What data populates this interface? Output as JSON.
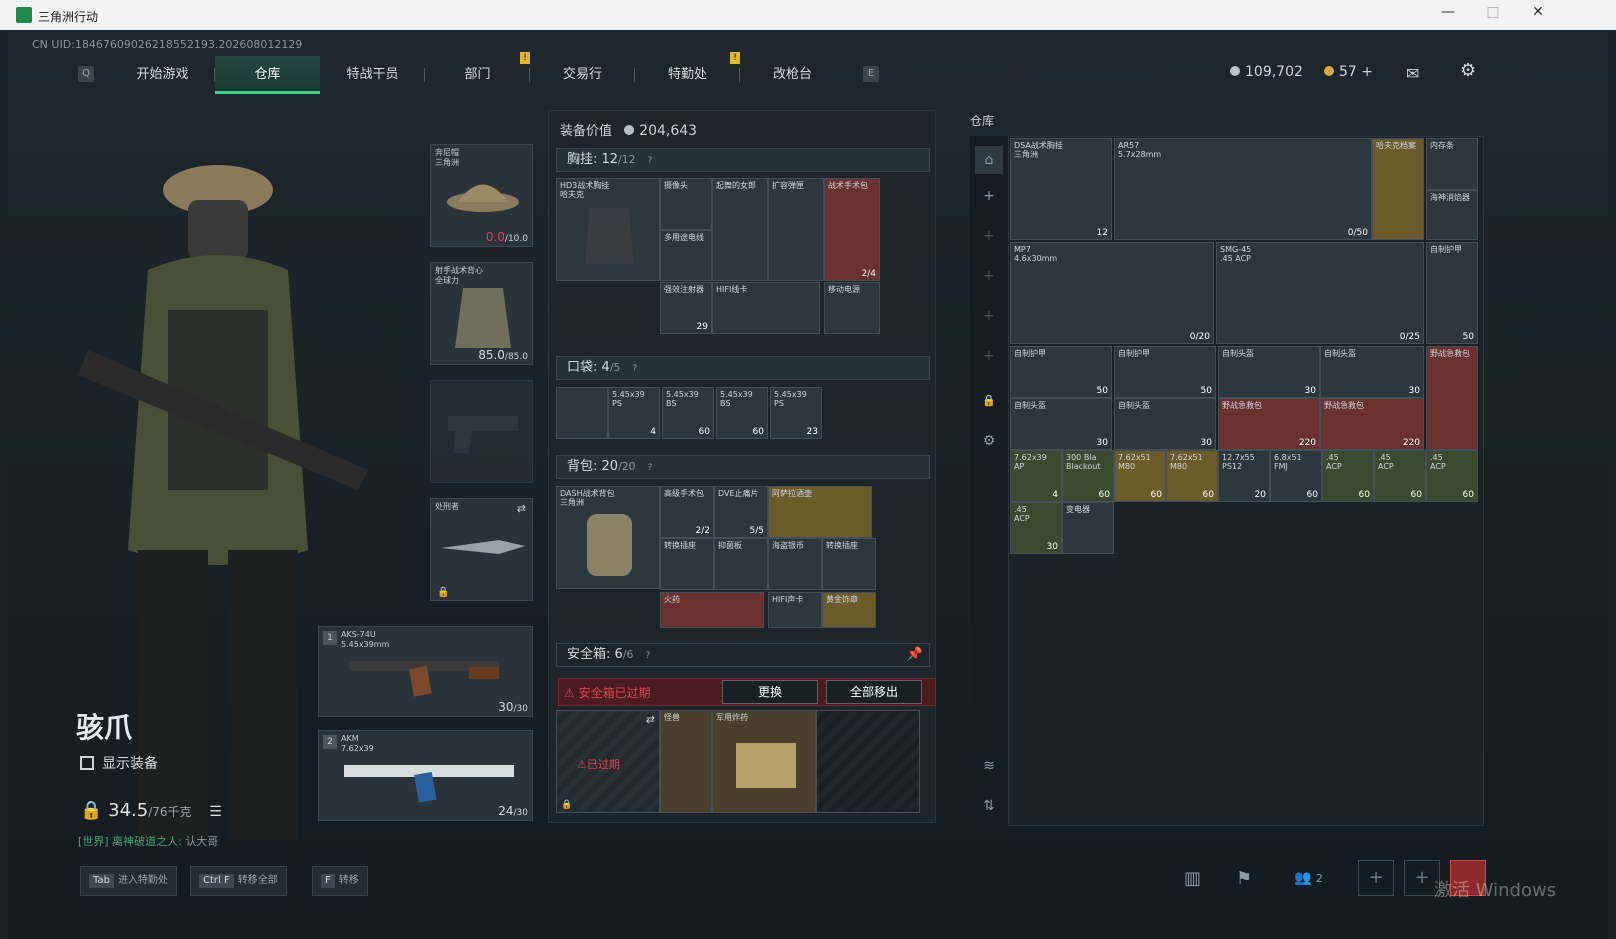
{
  "window": {
    "title": "三角洲行动"
  },
  "uid": "CN UID:1846760902621855219​3.202608012129",
  "nav": {
    "tabs": [
      "开始游戏",
      "仓库",
      "特战干员",
      "部门",
      "交易行",
      "特勤处",
      "改枪台"
    ],
    "active_index": 1,
    "left_key": "Q",
    "right_key": "E"
  },
  "currency": {
    "coins": "109,702",
    "gold": "57"
  },
  "character": {
    "name": "骇爪",
    "show_equipment": "显示装备",
    "weight": "34.5",
    "weight_max": "/76千克",
    "chat_channel": "[世界]",
    "chat_name": "离神破道之人:",
    "chat_msg": "认大哥"
  },
  "equip": {
    "helmet": {
      "label": "奔尼帽\n三角洲",
      "value": "0.0",
      "max": "/10.0"
    },
    "armor": {
      "label": "射手战术背心\n全球力",
      "value": "85.0",
      "max": "/85.0"
    },
    "melee": {
      "label": "处刑者"
    },
    "primary": {
      "num": "1",
      "label": "AKS-74U\n5.45x39mm",
      "ammo": "30",
      "max": "/30"
    },
    "secondary": {
      "num": "2",
      "label": "AKM\n7.62x39",
      "ammo": "24",
      "max": "/30"
    }
  },
  "gear": {
    "value_label": "装备价值",
    "value": "204,643",
    "chest": {
      "label": "胸挂:",
      "count": "12",
      "max": "/12",
      "item": "HD3战术胸挂\n哈夫克"
    },
    "chest_items": [
      {
        "name": "摄像头",
        "cnt": ""
      },
      {
        "name": "起舞的女郎",
        "cnt": ""
      },
      {
        "name": "扩容弹匣",
        "cnt": ""
      },
      {
        "name": "战术手术包",
        "cnt": "2/4"
      },
      {
        "name": "多用途电线",
        "cnt": ""
      },
      {
        "name": "强效注射器",
        "cnt": "29"
      },
      {
        "name": "HIFI线卡",
        "cnt": ""
      },
      {
        "name": "移动电源",
        "cnt": ""
      }
    ],
    "pocket": {
      "label": "口袋:",
      "count": "4",
      "max": "/5"
    },
    "pocket_items": [
      {
        "name": "5.45x39\nPS",
        "cnt": "4"
      },
      {
        "name": "5.45x39\nBS",
        "cnt": "60"
      },
      {
        "name": "5.45x39\nBS",
        "cnt": "60"
      },
      {
        "name": "5.45x39\nPS",
        "cnt": "23"
      }
    ],
    "backpack": {
      "label": "背包:",
      "count": "20",
      "max": "/20",
      "item": "DASH战术背包\n三角洲"
    },
    "backpack_items": [
      {
        "name": "高级手术包",
        "cnt": "2/2"
      },
      {
        "name": "DVE止痛片",
        "cnt": "5/5"
      },
      {
        "name": "阿萨拉酒壶",
        "cnt": ""
      },
      {
        "name": "转换插座",
        "cnt": ""
      },
      {
        "name": "抑菌板",
        "cnt": ""
      },
      {
        "name": "海盗银币",
        "cnt": ""
      },
      {
        "name": "转换插座",
        "cnt": ""
      },
      {
        "name": "火药",
        "cnt": ""
      },
      {
        "name": "HIFI声卡",
        "cnt": ""
      },
      {
        "name": "黄金饰章",
        "cnt": ""
      }
    ],
    "safebox": {
      "label": "安全箱:",
      "count": "6",
      "max": "/6",
      "expired": "安全箱已过期",
      "expired_tag": "已过期",
      "replace": "更换",
      "remove_all": "全部移出",
      "items": [
        "怪兽",
        "军用炸药"
      ]
    }
  },
  "warehouse": {
    "title": "仓库",
    "items": [
      {
        "name": "DSA战术胸挂\n三角洲",
        "cnt": "12"
      },
      {
        "name": "AR57\n5.7x28mm",
        "cnt": "0/50"
      },
      {
        "name": "哈夫克档案",
        "cnt": ""
      },
      {
        "name": "内存条",
        "cnt": ""
      },
      {
        "name": "海神消焰器",
        "cnt": ""
      },
      {
        "name": "MP7\n4.6x30mm",
        "cnt": "0/20"
      },
      {
        "name": "SMG-45\n.45 ACP",
        "cnt": "0/25"
      },
      {
        "name": "自制护甲",
        "cnt": "50"
      },
      {
        "name": "自制护甲",
        "cnt": "50"
      },
      {
        "name": "自制护甲",
        "cnt": "50"
      },
      {
        "name": "自制头盔",
        "cnt": "30"
      },
      {
        "name": "自制头盔",
        "cnt": "30"
      },
      {
        "name": "野战急救包",
        "cnt": ""
      },
      {
        "name": "自制头盔",
        "cnt": "30"
      },
      {
        "name": "自制头盔",
        "cnt": "30"
      },
      {
        "name": "野战急救包",
        "cnt": "220"
      },
      {
        "name": "野战急救包",
        "cnt": "220"
      },
      {
        "name": "",
        "cnt": "220"
      },
      {
        "name": "7.62x39\nAP",
        "cnt": "4"
      },
      {
        "name": "300 Bla\nBlackout",
        "cnt": "60"
      },
      {
        "name": "7.62x51\nM80",
        "cnt": "60"
      },
      {
        "name": "7.62x51\nM80",
        "cnt": "60"
      },
      {
        "name": "12.7x55\nPS12",
        "cnt": "20"
      },
      {
        "name": "6.8x51\nFMJ",
        "cnt": "60"
      },
      {
        "name": ".45\nACP",
        "cnt": "60"
      },
      {
        "name": ".45\nACP",
        "cnt": "60"
      },
      {
        "name": ".45\nACP",
        "cnt": "60"
      },
      {
        "name": ".45\nACP",
        "cnt": "30"
      },
      {
        "name": "变电器",
        "cnt": ""
      }
    ]
  },
  "hints": [
    {
      "key": "Tab",
      "text": "进入特勤处"
    },
    {
      "key": "Ctrl F",
      "text": "转移全部"
    },
    {
      "key": "F",
      "text": "转移"
    }
  ],
  "bottom": {
    "squad": "2",
    "watermark": "激活 Windows"
  },
  "colors": {
    "accent": "#3ad38a",
    "expired": "#e0444c"
  }
}
